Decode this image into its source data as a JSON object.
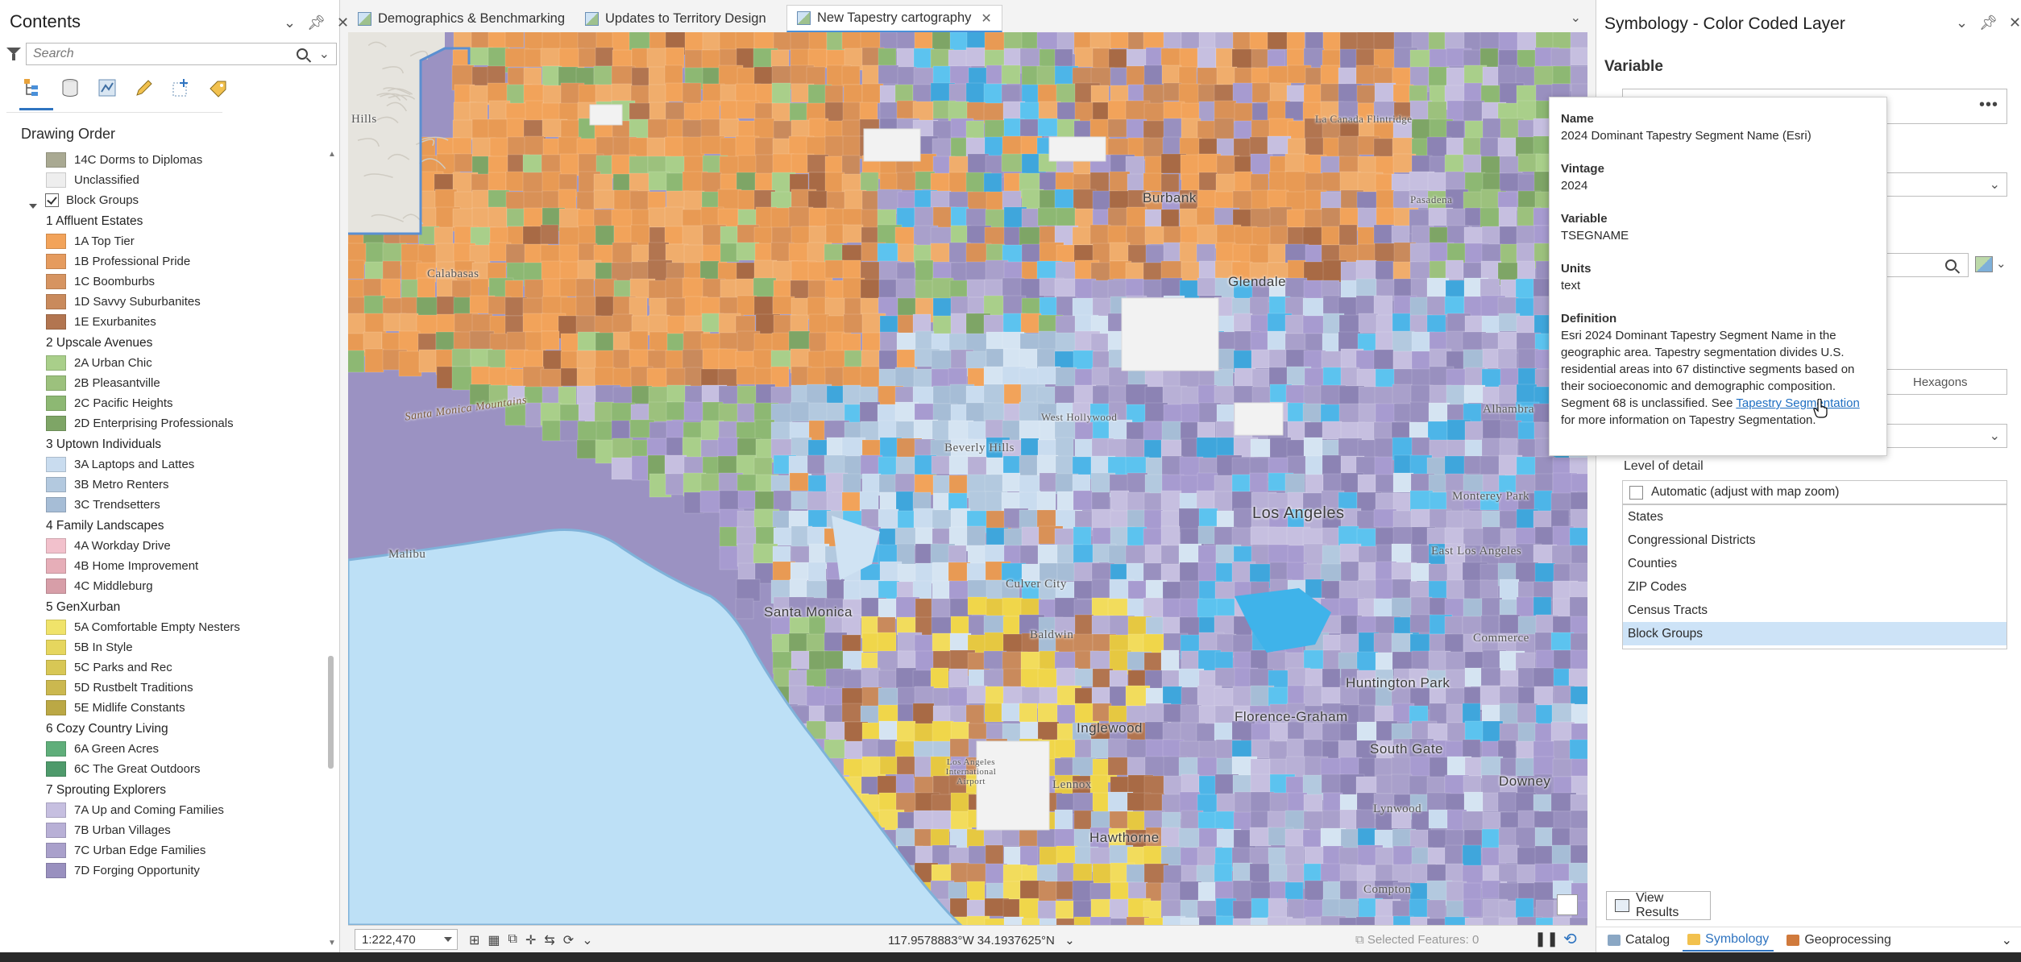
{
  "contents": {
    "title": "Contents",
    "search_placeholder": "Search",
    "drawing_order_label": "Drawing Order",
    "items": [
      {
        "type": "item",
        "label": "14C Dorms to Diplomas",
        "color": "#a9a992"
      },
      {
        "type": "item",
        "label": "Unclassified",
        "color": "#eeeeee"
      },
      {
        "type": "group",
        "label": "Block Groups"
      },
      {
        "type": "head",
        "label": "1 Affluent Estates"
      },
      {
        "type": "item",
        "label": "1A Top Tier",
        "color": "#f2a35a"
      },
      {
        "type": "item",
        "label": "1B Professional Pride",
        "color": "#e59b5e"
      },
      {
        "type": "item",
        "label": "1C Boomburbs",
        "color": "#d69461"
      },
      {
        "type": "item",
        "label": "1D Savvy Suburbanites",
        "color": "#c98a5c"
      },
      {
        "type": "item",
        "label": "1E Exurbanites",
        "color": "#b27550"
      },
      {
        "type": "head",
        "label": "2 Upscale Avenues"
      },
      {
        "type": "item",
        "label": "2A Urban Chic",
        "color": "#a9cf8a"
      },
      {
        "type": "item",
        "label": "2B Pleasantville",
        "color": "#9cc17d"
      },
      {
        "type": "item",
        "label": "2C Pacific Heights",
        "color": "#8db873"
      },
      {
        "type": "item",
        "label": "2D Enterprising Professionals",
        "color": "#7ea566"
      },
      {
        "type": "head",
        "label": "3 Uptown Individuals"
      },
      {
        "type": "item",
        "label": "3A Laptops and Lattes",
        "color": "#c9dcef"
      },
      {
        "type": "item",
        "label": "3B Metro Renters",
        "color": "#b3c9df"
      },
      {
        "type": "item",
        "label": "3C Trendsetters",
        "color": "#a6bdd6"
      },
      {
        "type": "head",
        "label": "4 Family Landscapes"
      },
      {
        "type": "item",
        "label": "4A Workday Drive",
        "color": "#f2c1cc"
      },
      {
        "type": "item",
        "label": "4B Home Improvement",
        "color": "#e6aeb8"
      },
      {
        "type": "item",
        "label": "4C Middleburg",
        "color": "#d79ea8"
      },
      {
        "type": "head",
        "label": "5 GenXurban"
      },
      {
        "type": "item",
        "label": "5A Comfortable Empty Nesters",
        "color": "#f0e36a"
      },
      {
        "type": "item",
        "label": "5B In Style",
        "color": "#e6d65e"
      },
      {
        "type": "item",
        "label": "5C Parks and Rec",
        "color": "#d8c755"
      },
      {
        "type": "item",
        "label": "5D Rustbelt Traditions",
        "color": "#cbb84f"
      },
      {
        "type": "item",
        "label": "5E Midlife Constants",
        "color": "#bba845"
      },
      {
        "type": "head",
        "label": "6 Cozy Country Living"
      },
      {
        "type": "item",
        "label": "6A Green Acres",
        "color": "#5fae7a"
      },
      {
        "type": "item",
        "label": "6C The Great Outdoors",
        "color": "#4e9a6b"
      },
      {
        "type": "head",
        "label": "7 Sprouting Explorers"
      },
      {
        "type": "item",
        "label": "7A Up and Coming Families",
        "color": "#c6bfe0"
      },
      {
        "type": "item",
        "label": "7B Urban Villages",
        "color": "#b8b0d6"
      },
      {
        "type": "item",
        "label": "7C Urban Edge Families",
        "color": "#a9a0cb"
      },
      {
        "type": "item",
        "label": "7D Forging Opportunity",
        "color": "#9990bf"
      }
    ]
  },
  "tabs": [
    {
      "label": "Demographics & Benchmarking",
      "active": false
    },
    {
      "label": "Updates to Territory Design",
      "active": false
    },
    {
      "label": "New Tapestry cartography",
      "active": true
    }
  ],
  "map": {
    "labels": {
      "hills": "Hills",
      "calabasas": "Calabasas",
      "santa_monica_mountains": "Santa Monica Mountains",
      "malibu": "Malibu",
      "santa_monica": "Santa Monica",
      "burbank": "Burbank",
      "glendale": "Glendale",
      "los_angeles": "Los Angeles",
      "culver_city": "Culver City",
      "inglewood": "Inglewood",
      "hawthorne": "Hawthorne",
      "huntington_park": "Huntington Park",
      "florence_graham": "Florence-Graham",
      "south_gate": "South Gate",
      "east_los_angeles": "East Los Angeles",
      "monterey_park": "Monterey Park",
      "commerce": "Commerce",
      "downey": "Downey",
      "lynwood": "Lynwood",
      "compton": "Compton",
      "lennox": "Lennox",
      "beverly_hills": "Beverly Hills",
      "west_hollywood": "West Hollywood",
      "alhambra": "Alhambra",
      "la_canada": "La Canada Flintridge",
      "pasadena": "Pasadena",
      "baldwin": "Baldwin",
      "airport": "Los Angeles International Airport"
    }
  },
  "status": {
    "scale": "1:222,470",
    "coordinates": "117.9578883°W 34.1937625°N",
    "selected_features": "Selected Features: 0"
  },
  "symbology": {
    "title": "Symbology - Color Coded Layer",
    "variable_label": "Variable",
    "hexagons_text": "Hexagons",
    "lod_label": "Level of detail",
    "lod_auto": "Automatic (adjust with map zoom)",
    "lod_options": [
      "States",
      "Congressional Districts",
      "Counties",
      "ZIP Codes",
      "Census Tracts",
      "Block Groups"
    ],
    "lod_selected": "Block Groups",
    "view_results": "View Results",
    "bottom_tabs": [
      "Catalog",
      "Symbology",
      "Geoprocessing"
    ]
  },
  "tooltip": {
    "name_label": "Name",
    "name_value": "2024 Dominant Tapestry Segment Name (Esri)",
    "vintage_label": "Vintage",
    "vintage_value": "2024",
    "variable_label": "Variable",
    "variable_value": "TSEGNAME",
    "units_label": "Units",
    "units_value": "text",
    "definition_label": "Definition",
    "definition_text": "Esri 2024 Dominant Tapestry Segment Name in the geographic area. Tapestry segmentation divides U.S. residential areas into 67 distinctive segments based on their socioeconomic and demographic composition. Segment 68 is unclassified. See ",
    "definition_link": "Tapestry Segmentation",
    "definition_tail": " for more information on Tapestry Segmentation."
  }
}
